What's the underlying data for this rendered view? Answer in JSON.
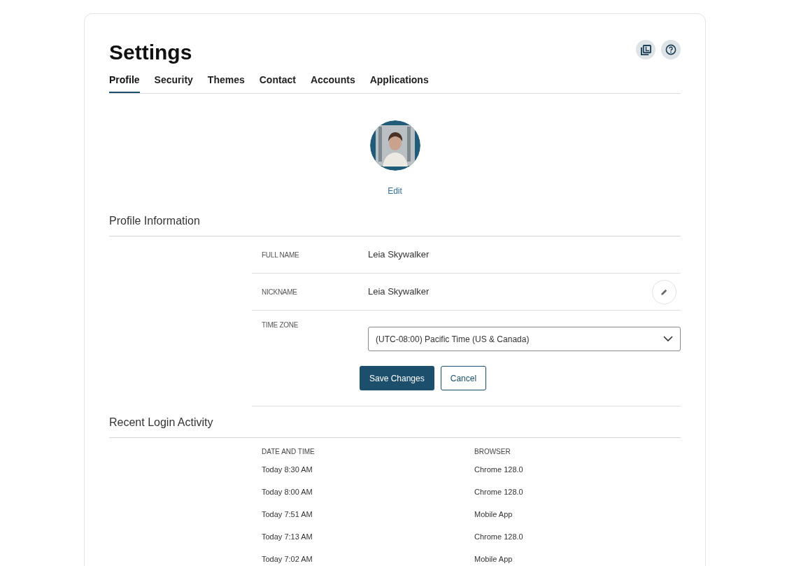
{
  "title": "Settings",
  "tabs": [
    {
      "label": "Profile",
      "selected": true
    },
    {
      "label": "Security",
      "selected": false
    },
    {
      "label": "Themes",
      "selected": false
    },
    {
      "label": "Contact",
      "selected": false
    },
    {
      "label": "Accounts",
      "selected": false
    },
    {
      "label": "Applications",
      "selected": false
    }
  ],
  "avatar": {
    "kind": "picture",
    "edit_link": "Edit"
  },
  "profile_section": {
    "title": "Profile Information",
    "fields": [
      {
        "kind": "text",
        "label": "FULL NAME",
        "value": "Leia Skywalker"
      },
      {
        "kind": "editable",
        "label": "NICKNAME",
        "value": "Leia Skywalker"
      },
      {
        "kind": "select",
        "label": "TIME ZONE",
        "value": "(UTC-08:00) Pacific Time (US & Canada)"
      }
    ],
    "buttons": [
      {
        "kind": "primary",
        "label": "Save Changes"
      },
      {
        "kind": "secondary",
        "label": "Cancel"
      }
    ]
  },
  "login_section": {
    "title": "Recent Login Activity",
    "columns": [
      "DATE AND TIME",
      "BROWSER"
    ],
    "rows": [
      [
        "Today 8:30 AM",
        "Chrome 128.0"
      ],
      [
        "Today 8:00 AM",
        "Chrome 128.0"
      ],
      [
        "Today 7:51 AM",
        "Mobile App"
      ],
      [
        "Today 7:13 AM",
        "Chrome 128.0"
      ],
      [
        "Today 7:02 AM",
        "Mobile App"
      ]
    ]
  }
}
